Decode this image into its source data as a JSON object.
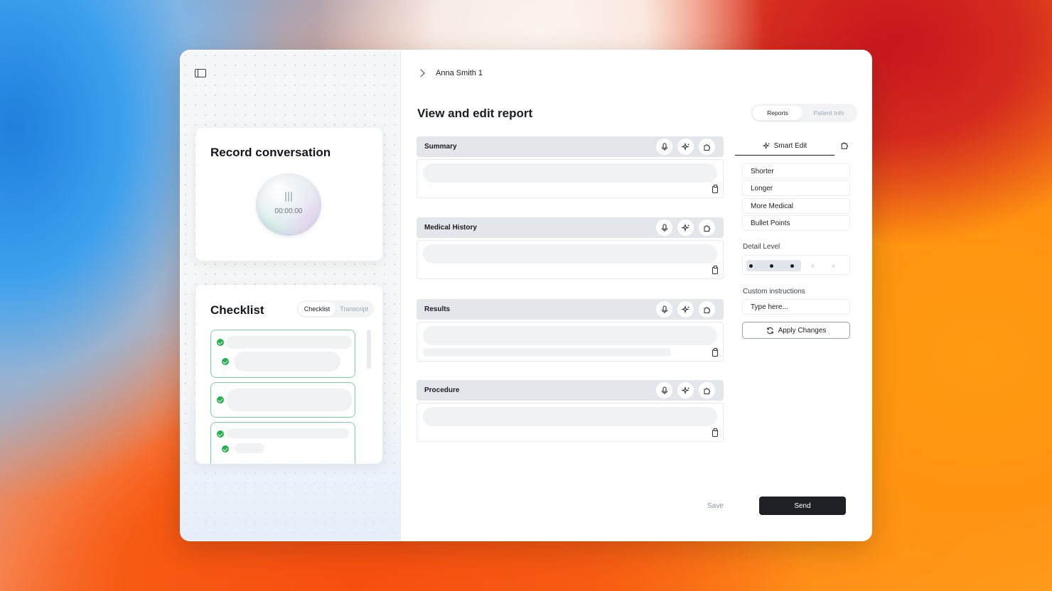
{
  "breadcrumb": {
    "patient_name": "Anna Smith 1"
  },
  "page": {
    "title": "View and edit report"
  },
  "view_tabs": [
    {
      "label": "Reports",
      "active": true
    },
    {
      "label": "Patient Info",
      "active": false
    }
  ],
  "record": {
    "title": "Record conversation",
    "time": "00:00:00"
  },
  "checklist": {
    "title": "Checklist",
    "tabs": [
      {
        "label": "Checklist",
        "active": true
      },
      {
        "label": "Transcript",
        "active": false
      }
    ]
  },
  "sections": [
    {
      "label": "Summary"
    },
    {
      "label": "Medical History"
    },
    {
      "label": "Results"
    },
    {
      "label": "Procedure"
    }
  ],
  "smart_edit": {
    "tab_label": "Smart Edit",
    "options": [
      "Shorter",
      "Longer",
      "More Medical",
      "Bullet Points"
    ],
    "detail_level_label": "Detail Level",
    "detail_level": {
      "value": 3,
      "max": 5
    },
    "custom_instructions_label": "Custom instructions",
    "custom_instructions_placeholder": "Type here...",
    "apply_label": "Apply Changes"
  },
  "actions": {
    "save_label": "Save",
    "send_label": "Send"
  },
  "colors": {
    "accent_dark": "#1f2126",
    "check_green": "#22b24c",
    "check_border": "#7fd19a"
  },
  "icons": {
    "sidebar_toggle": "sidebar-panel-icon",
    "breadcrumb": "chevron-right-icon",
    "section_actions": [
      "microphone-icon",
      "sparkles-icon",
      "puzzle-icon"
    ],
    "copy": "clipboard-icon",
    "apply": "refresh-icon"
  }
}
